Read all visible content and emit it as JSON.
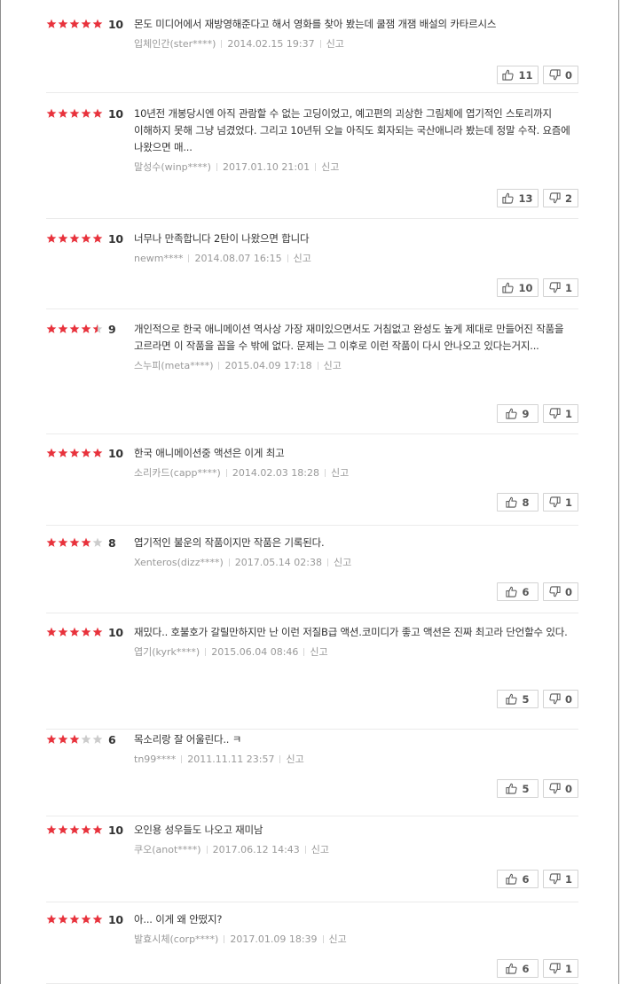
{
  "reviews": [
    {
      "stars": 5,
      "score": "10",
      "text": "몬도 미디어에서 재방영해준다고 해서 영화를 찾아 봤는데 쿨잼 개잼 배설의 카타르시스",
      "author": "입체인간(ster****)",
      "date": "2014.02.15 19:37",
      "report": "신고",
      "up": "11",
      "down": "0"
    },
    {
      "stars": 5,
      "score": "10",
      "text": "10년전 개봉당시엔 아직 관람할 수 없는 고딩이었고, 예고편의 괴상한 그림체에 엽기적인 스토리까지 이해하지 못해 그냥 넘겼었다. 그리고 10년뒤 오늘 아직도 회자되는 국산애니라 봤는데 정말 수작. 요즘에 나왔으면 매...",
      "author": "말성수(winp****)",
      "date": "2017.01.10 21:01",
      "report": "신고",
      "up": "13",
      "down": "2"
    },
    {
      "stars": 5,
      "score": "10",
      "text": "너무나 만족합니다 2탄이 나왔으면 합니다",
      "author": "newm****",
      "date": "2014.08.07 16:15",
      "report": "신고",
      "up": "10",
      "down": "1"
    },
    {
      "stars": 4.5,
      "score": "9",
      "text": "개인적으로 한국 애니메이션 역사상 가장 재미있으면서도 거침없고 완성도 높게 제대로 만들어진 작품을 고르라면 이 작품을 꼽을 수 밖에 없다. 문제는 그 이후로 이런 작품이 다시 안나오고 있다는거지...",
      "author": "스누피(meta****)",
      "date": "2015.04.09 17:18",
      "report": "신고",
      "up": "9",
      "down": "1"
    },
    {
      "stars": 5,
      "score": "10",
      "text": "한국 애니메이션중 액션은 이게 최고",
      "author": "소리카드(capp****)",
      "date": "2014.02.03 18:28",
      "report": "신고",
      "up": "8",
      "down": "1"
    },
    {
      "stars": 4,
      "score": "8",
      "text": "엽기적인 불운의 작품이지만 작품은 기록된다.",
      "author": "Xenteros(dizz****)",
      "date": "2017.05.14 02:38",
      "report": "신고",
      "up": "6",
      "down": "0"
    },
    {
      "stars": 5,
      "score": "10",
      "text": "재밌다.. 호불호가 갈릴만하지만 난 이런 저질B급 액션.코미디가 좋고 액션은 진짜 최고라 단언할수 있다.",
      "author": "엽기(kyrk****)",
      "date": "2015.06.04 08:46",
      "report": "신고",
      "up": "5",
      "down": "0"
    },
    {
      "stars": 3,
      "score": "6",
      "text": "목소리랑 잘 어울린다.. ㅋ",
      "author": "tn99****",
      "date": "2011.11.11 23:57",
      "report": "신고",
      "up": "5",
      "down": "0"
    },
    {
      "stars": 5,
      "score": "10",
      "text": "오인용 성우들도 나오고 재미남",
      "author": "쿠오(anot****)",
      "date": "2017.06.12 14:43",
      "report": "신고",
      "up": "6",
      "down": "1"
    },
    {
      "stars": 5,
      "score": "10",
      "text": "아... 이게 왜 안떴지?",
      "author": "발효시체(corp****)",
      "date": "2017.01.09 18:39",
      "report": "신고",
      "up": "6",
      "down": "1"
    }
  ],
  "colors": {
    "star_on": "#e8323c",
    "star_off": "#cccccc"
  },
  "icons": {
    "up": "thumbs-up-icon",
    "down": "thumbs-down-icon"
  }
}
